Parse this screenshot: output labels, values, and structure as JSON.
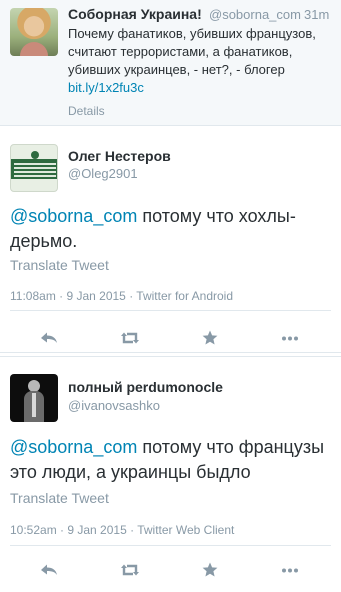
{
  "parent_tweet": {
    "name": "Соборная Украина!",
    "handle": "@soborna_com",
    "time": "31m",
    "text": "Почему фанатиков, убивших французов, считают террористами, а фанатиков, убивших украинцев, - нет?, - блогер ",
    "link": "bit.ly/1x2fu3c",
    "details_label": "Details"
  },
  "replies": [
    {
      "name": "Олег Нестеров",
      "handle": "@Oleg2901",
      "mention": "@soborna_com",
      "text": " потому что хохлы-дерьмо.",
      "translate_label": "Translate Tweet",
      "meta": "11:08am · 9 Jan 2015 · Twitter for Android"
    },
    {
      "name": "полный perdumonocle",
      "handle": "@ivanovsashko",
      "mention": "@soborna_com",
      "text": " потому что французы это люди, а украинцы быдло",
      "translate_label": "Translate Tweet",
      "meta": "10:52am · 9 Jan 2015 · Twitter Web Client"
    }
  ],
  "icons": {
    "reply": "reply-icon",
    "retweet": "retweet-icon",
    "favorite": "star-icon",
    "more": "more-dots-icon"
  },
  "colors": {
    "link": "#0084b4",
    "muted": "#8899a6",
    "text": "#292f33",
    "icon": "#8899a6"
  }
}
